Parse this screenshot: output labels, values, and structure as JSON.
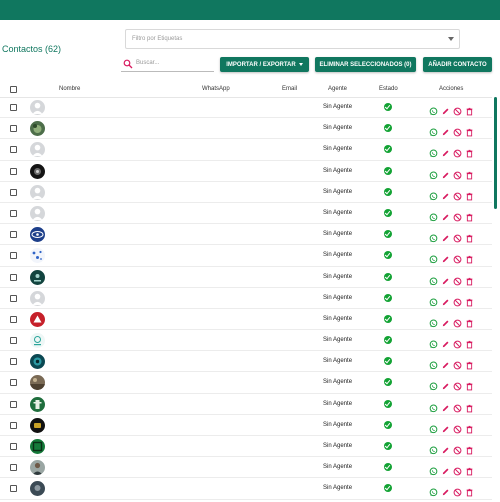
{
  "contacts": {
    "title": "Contactos (62)"
  },
  "filter": {
    "placeholder": "Filtro por Etiquetas"
  },
  "search": {
    "placeholder": "Buscar..."
  },
  "toolbar": {
    "import_export_label": "IMPORTAR / EXPORTAR",
    "delete_selected_label": "ELIMINAR SELECCIONADOS (0)",
    "add_contact_label": "AÑADIR CONTACTO"
  },
  "table": {
    "headers": {
      "name": "Nombre",
      "whatsapp": "WhatsApp",
      "email": "Email",
      "agent": "Agente",
      "status": "Estado",
      "actions": "Acciones"
    },
    "rows": [
      {
        "agent": "Sin Agente",
        "avatar": "default"
      },
      {
        "agent": "Sin Agente",
        "avatar": "photo-green"
      },
      {
        "agent": "Sin Agente",
        "avatar": "default"
      },
      {
        "agent": "Sin Agente",
        "avatar": "photo-dark"
      },
      {
        "agent": "Sin Agente",
        "avatar": "default"
      },
      {
        "agent": "Sin Agente",
        "avatar": "default"
      },
      {
        "agent": "Sin Agente",
        "avatar": "logo-blue"
      },
      {
        "agent": "Sin Agente",
        "avatar": "logo-dots"
      },
      {
        "agent": "Sin Agente",
        "avatar": "logo-teal"
      },
      {
        "agent": "Sin Agente",
        "avatar": "default"
      },
      {
        "agent": "Sin Agente",
        "avatar": "logo-red"
      },
      {
        "agent": "Sin Agente",
        "avatar": "logo-light"
      },
      {
        "agent": "Sin Agente",
        "avatar": "photo-eye"
      },
      {
        "agent": "Sin Agente",
        "avatar": "photo-brown"
      },
      {
        "agent": "Sin Agente",
        "avatar": "logo-green"
      },
      {
        "agent": "Sin Agente",
        "avatar": "logo-black"
      },
      {
        "agent": "Sin Agente",
        "avatar": "logo-greenbox"
      },
      {
        "agent": "Sin Agente",
        "avatar": "photo-person"
      },
      {
        "agent": "Sin Agente",
        "avatar": "photo-gray"
      }
    ]
  },
  "colors": {
    "brand": "#10775f",
    "status_active": "#13a334",
    "action_icons": "#d81b60",
    "whatsapp_icon": "#1b9e3e"
  },
  "icons": {
    "search": "search-icon",
    "whatsapp": "whatsapp-icon",
    "edit": "pencil-icon",
    "block": "block-icon",
    "delete": "trash-icon",
    "status": "check-circle-icon"
  }
}
